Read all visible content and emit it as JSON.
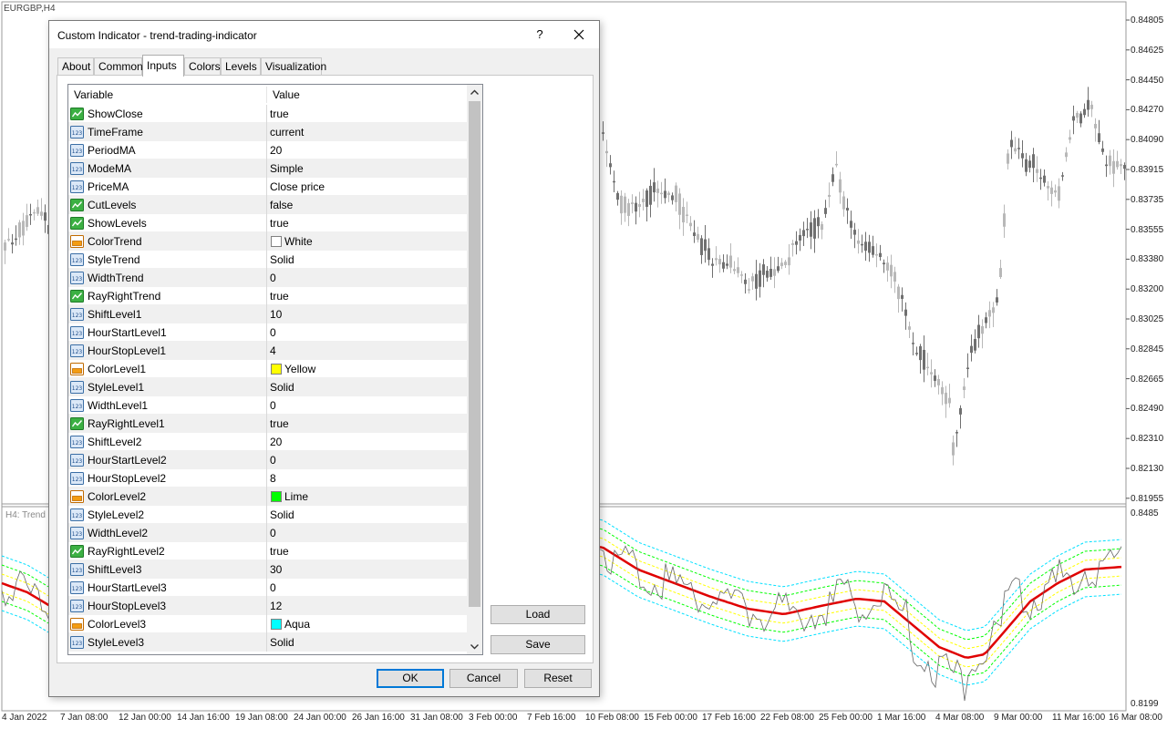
{
  "chart": {
    "symbol": "EURGBP,H4",
    "subwindow_label": "H4: Trend",
    "sub_value_top": "0.8485",
    "sub_value_bottom": "0.8199",
    "price_labels": [
      "0.84805",
      "0.84625",
      "0.84450",
      "0.84270",
      "0.84090",
      "0.83915",
      "0.83735",
      "0.83555",
      "0.83380",
      "0.83200",
      "0.83025",
      "0.82845",
      "0.82665",
      "0.82490",
      "0.82310",
      "0.82130",
      "0.81955"
    ],
    "date_labels": [
      "4 Jan 2022",
      "7 Jan 08:00",
      "12 Jan 00:00",
      "14 Jan 16:00",
      "19 Jan 08:00",
      "24 Jan 00:00",
      "26 Jan 16:00",
      "31 Jan 08:00",
      "3 Feb 00:00",
      "7 Feb 16:00",
      "10 Feb 08:00",
      "15 Feb 00:00",
      "17 Feb 16:00",
      "22 Feb 08:00",
      "25 Feb 00:00",
      "1 Mar 16:00",
      "4 Mar 08:00",
      "9 Mar 00:00",
      "11 Mar 16:00",
      "16 Mar 08:00"
    ],
    "colors": {
      "trend": "#e00000",
      "level1": "#ffff00",
      "level2": "#00ff00",
      "level3": "#00e0ff",
      "price": "#666666",
      "candle_up": "#b8b8b8",
      "candle_down": "#707070"
    }
  },
  "dialog": {
    "title": "Custom Indicator - trend-trading-indicator",
    "help": "?",
    "tabs": [
      "About",
      "Common",
      "Inputs",
      "Colors",
      "Levels",
      "Visualization"
    ],
    "active_tab": "Inputs",
    "grid": {
      "col_variable": "Variable",
      "col_value": "Value",
      "rows": [
        {
          "icon": "bool",
          "name": "ShowClose",
          "value": "true"
        },
        {
          "icon": "int",
          "name": "TimeFrame",
          "value": "current"
        },
        {
          "icon": "int",
          "name": "PeriodMA",
          "value": "20"
        },
        {
          "icon": "int",
          "name": "ModeMA",
          "value": "Simple"
        },
        {
          "icon": "int",
          "name": "PriceMA",
          "value": "Close price"
        },
        {
          "icon": "bool",
          "name": "CutLevels",
          "value": "false"
        },
        {
          "icon": "bool",
          "name": "ShowLevels",
          "value": "true"
        },
        {
          "icon": "color",
          "name": "ColorTrend",
          "value": "White",
          "swatch": "#ffffff"
        },
        {
          "icon": "int",
          "name": "StyleTrend",
          "value": "Solid"
        },
        {
          "icon": "int",
          "name": "WidthTrend",
          "value": "0"
        },
        {
          "icon": "bool",
          "name": "RayRightTrend",
          "value": "true"
        },
        {
          "icon": "int",
          "name": "ShiftLevel1",
          "value": "10"
        },
        {
          "icon": "int",
          "name": "HourStartLevel1",
          "value": "0"
        },
        {
          "icon": "int",
          "name": "HourStopLevel1",
          "value": "4"
        },
        {
          "icon": "color",
          "name": "ColorLevel1",
          "value": "Yellow",
          "swatch": "#ffff00"
        },
        {
          "icon": "int",
          "name": "StyleLevel1",
          "value": "Solid"
        },
        {
          "icon": "int",
          "name": "WidthLevel1",
          "value": "0"
        },
        {
          "icon": "bool",
          "name": "RayRightLevel1",
          "value": "true"
        },
        {
          "icon": "int",
          "name": "ShiftLevel2",
          "value": "20"
        },
        {
          "icon": "int",
          "name": "HourStartLevel2",
          "value": "0"
        },
        {
          "icon": "int",
          "name": "HourStopLevel2",
          "value": "8"
        },
        {
          "icon": "color",
          "name": "ColorLevel2",
          "value": "Lime",
          "swatch": "#00ff00"
        },
        {
          "icon": "int",
          "name": "StyleLevel2",
          "value": "Solid"
        },
        {
          "icon": "int",
          "name": "WidthLevel2",
          "value": "0"
        },
        {
          "icon": "bool",
          "name": "RayRightLevel2",
          "value": "true"
        },
        {
          "icon": "int",
          "name": "ShiftLevel3",
          "value": "30"
        },
        {
          "icon": "int",
          "name": "HourStartLevel3",
          "value": "0"
        },
        {
          "icon": "int",
          "name": "HourStopLevel3",
          "value": "12"
        },
        {
          "icon": "color",
          "name": "ColorLevel3",
          "value": "Aqua",
          "swatch": "#00ffff"
        },
        {
          "icon": "int",
          "name": "StyleLevel3",
          "value": "Solid"
        }
      ]
    },
    "buttons": {
      "load": "Load",
      "save": "Save",
      "ok": "OK",
      "cancel": "Cancel",
      "reset": "Reset"
    }
  }
}
